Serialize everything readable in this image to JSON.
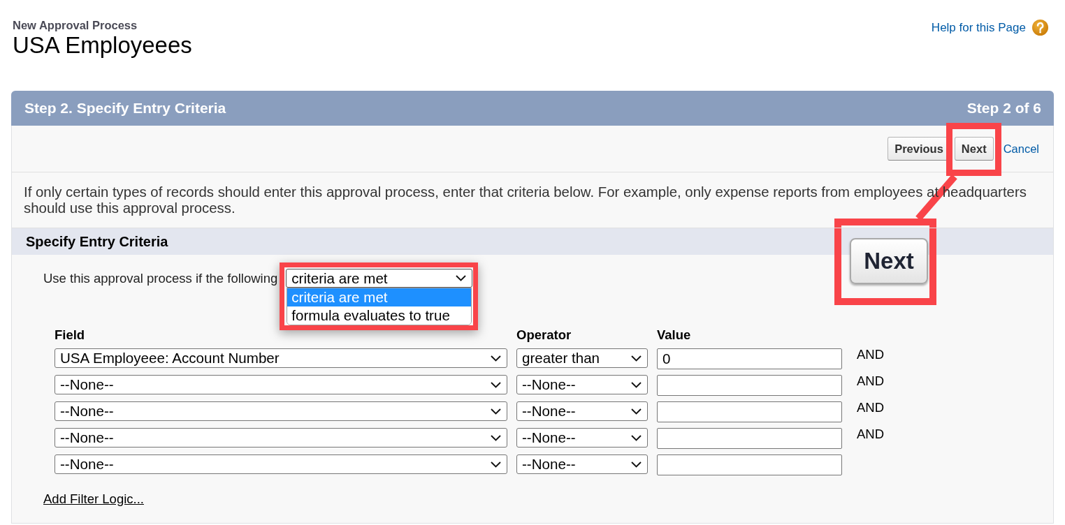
{
  "page_header": {
    "subtitle": "New Approval Process",
    "title": "USA Employeees",
    "help_link": "Help for this Page"
  },
  "wizard": {
    "title": "Step 2. Specify Entry Criteria",
    "step": "Step 2 of 6",
    "actions": [
      {
        "kind": "button",
        "label": "Previous",
        "highlighted": false
      },
      {
        "kind": "button",
        "label": "Next",
        "highlighted": true
      },
      {
        "kind": "link",
        "label": "Cancel",
        "highlighted": false
      }
    ],
    "description": "If only certain types of records should enter this approval process, enter that criteria below. For example, only expense reports from employees at headquarters should use this approval process."
  },
  "entry_criteria": {
    "title": "Specify Entry Criteria",
    "label": "Use this approval process if the following",
    "select": {
      "value": "criteria are met",
      "expanded": true,
      "highlighted": true,
      "options": [
        {
          "label": "criteria are met",
          "selected": true
        },
        {
          "label": "formula evaluates to true",
          "selected": false
        }
      ]
    },
    "filters": {
      "columns": [
        "Field",
        "Operator",
        "Value"
      ],
      "rows": [
        {
          "field": "USA Employeee: Account Number",
          "operator": "greater than",
          "value": "0",
          "joiner": "AND"
        },
        {
          "field": "--None--",
          "operator": "--None--",
          "value": "",
          "joiner": "AND"
        },
        {
          "field": "--None--",
          "operator": "--None--",
          "value": "",
          "joiner": "AND"
        },
        {
          "field": "--None--",
          "operator": "--None--",
          "value": "",
          "joiner": "AND"
        },
        {
          "field": "--None--",
          "operator": "--None--",
          "value": ""
        }
      ]
    },
    "filter_logic_link": "Add Filter Logic..."
  },
  "callout": {
    "label": "Next"
  }
}
